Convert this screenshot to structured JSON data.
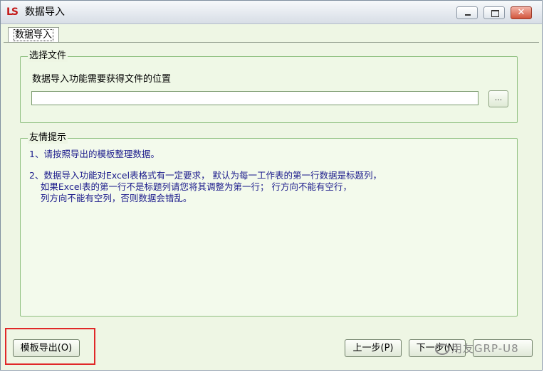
{
  "window": {
    "logo": "LS",
    "title": "数据导入",
    "minimize_icon": "minimize-icon",
    "maximize_icon": "maximize-icon",
    "close_icon": "close-icon",
    "close_glyph": "✕"
  },
  "tabs": [
    {
      "label": "数据导入",
      "selected": true
    }
  ],
  "select_file": {
    "legend": "选择文件",
    "description": "数据导入功能需要获得文件的位置",
    "path_value": "",
    "browse_label": "..."
  },
  "tips": {
    "legend": "友情提示",
    "item1": "1、请按照导出的模板整理数据。",
    "item2": "2、数据导入功能对Excel表格式有一定要求， 默认为每一工作表的第一行数据是标题列，\n    如果Excel表的第一行不是标题列请您将其调整为第一行； 行方向不能有空行，\n    列方向不能有空列，否则数据会错乱。"
  },
  "buttons": {
    "export_template": "模板导出(O)",
    "prev": "上一步(P)",
    "next": "下一步(N)",
    "finish": ""
  },
  "watermark": "用友GRP-U8",
  "colors": {
    "highlight": "#e02828",
    "tip_text": "#1b1b8c",
    "panel_bg": "#eef6e4"
  }
}
